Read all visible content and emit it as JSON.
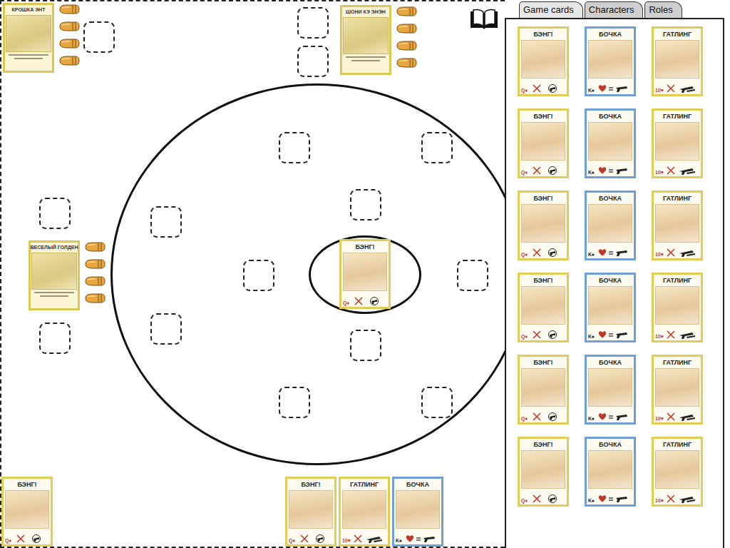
{
  "panel": {
    "tabs": [
      {
        "label": "Game cards",
        "selected": true
      },
      {
        "label": "Characters",
        "selected": false
      },
      {
        "label": "Roles",
        "selected": false
      }
    ],
    "cards": [
      {
        "title": "БЭНГ!",
        "rank": "Q♦",
        "kind": "bang",
        "color": "#e3cc55"
      },
      {
        "title": "БОЧКА",
        "rank": "K♠",
        "kind": "barrel",
        "color": "#6f9fd6"
      },
      {
        "title": "ГАТЛИНГ",
        "rank": "10♥",
        "kind": "gatling",
        "color": "#e3cc55"
      },
      {
        "title": "БЭНГ!",
        "rank": "Q♦",
        "kind": "bang",
        "color": "#e3cc55"
      },
      {
        "title": "БОЧКА",
        "rank": "K♠",
        "kind": "barrel",
        "color": "#6f9fd6"
      },
      {
        "title": "ГАТЛИНГ",
        "rank": "10♥",
        "kind": "gatling",
        "color": "#e3cc55"
      },
      {
        "title": "БЭНГ!",
        "rank": "Q♦",
        "kind": "bang",
        "color": "#e3cc55"
      },
      {
        "title": "БОЧКА",
        "rank": "K♠",
        "kind": "barrel",
        "color": "#6f9fd6"
      },
      {
        "title": "ГАТЛИНГ",
        "rank": "10♥",
        "kind": "gatling",
        "color": "#e3cc55"
      },
      {
        "title": "БЭНГ!",
        "rank": "Q♦",
        "kind": "bang",
        "color": "#e3cc55"
      },
      {
        "title": "БОЧКА",
        "rank": "K♠",
        "kind": "barrel",
        "color": "#6f9fd6"
      },
      {
        "title": "ГАТЛИНГ",
        "rank": "10♥",
        "kind": "gatling",
        "color": "#e3cc55"
      },
      {
        "title": "БЭНГ!",
        "rank": "Q♦",
        "kind": "bang",
        "color": "#e3cc55"
      },
      {
        "title": "БОЧКА",
        "rank": "K♠",
        "kind": "barrel",
        "color": "#6f9fd6"
      },
      {
        "title": "ГАТЛИНГ",
        "rank": "10♥",
        "kind": "gatling",
        "color": "#e3cc55"
      },
      {
        "title": "БЭНГ!",
        "rank": "Q♦",
        "kind": "bang",
        "color": "#e3cc55"
      },
      {
        "title": "БОЧКА",
        "rank": "K♠",
        "kind": "barrel",
        "color": "#6f9fd6"
      },
      {
        "title": "ГАТЛИНГ",
        "rank": "10♥",
        "kind": "gatling",
        "color": "#e3cc55"
      }
    ]
  },
  "players": [
    {
      "character": "КРОШКА ЭНТ",
      "bullets": 4
    },
    {
      "character": "ШОНИ КЭ ЭНЭН",
      "bullets": 4
    },
    {
      "character": "ВЕСЕЛЫЙ ГОЛДЕН",
      "bullets": 4
    }
  ],
  "table": {
    "center_card": {
      "title": "БЭНГ!",
      "rank": "Q♦",
      "kind": "bang",
      "color": "#e3cc55"
    }
  },
  "hand": {
    "left_card": {
      "title": "БЭНГ!",
      "rank": "Q♦",
      "kind": "bang",
      "color": "#e3cc55"
    },
    "cards": [
      {
        "title": "БЭНГ!",
        "rank": "Q♦",
        "kind": "bang",
        "color": "#e3cc55"
      },
      {
        "title": "ГАТЛИНГ",
        "rank": "10♥",
        "kind": "gatling",
        "color": "#e3cc55"
      },
      {
        "title": "БОЧКА",
        "rank": "K♠",
        "kind": "barrel",
        "color": "#6f9fd6"
      }
    ]
  }
}
